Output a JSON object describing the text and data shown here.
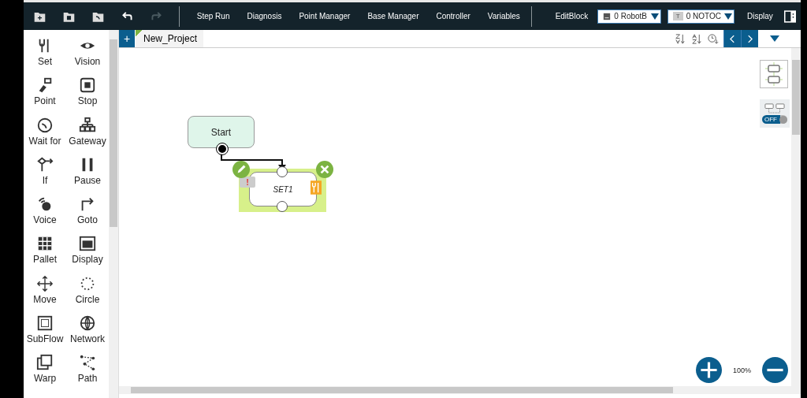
{
  "toolbar": {
    "undo": {
      "disabled": false
    },
    "redo": {
      "disabled": true
    },
    "menu": [
      "Step Run",
      "Diagnosis",
      "Point Manager",
      "Base Manager",
      "Controller",
      "Variables"
    ],
    "edit_block": "EditBlock",
    "robot_select": {
      "value": "0 RobotB"
    },
    "tool_select": {
      "badge": "T",
      "value": "0 NOTOC"
    },
    "display": "Display"
  },
  "tabs": [
    {
      "label": "New_Project",
      "selected": true
    }
  ],
  "add_tab": "+",
  "palette": [
    "Set",
    "Vision",
    "Point",
    "Stop",
    "Wait for",
    "Gateway",
    "If",
    "Pause",
    "Voice",
    "Goto",
    "Pallet",
    "Display",
    "Move",
    "Circle",
    "SubFlow",
    "Network",
    "Warp",
    "Path"
  ],
  "flow": {
    "start": {
      "label": "Start"
    },
    "nodes": [
      {
        "label": "SET1",
        "selected": true,
        "warning": "!"
      }
    ]
  },
  "side_panel": {
    "toggle": {
      "label": "OFF",
      "on": false
    }
  },
  "zoom": {
    "reading": "100%"
  }
}
